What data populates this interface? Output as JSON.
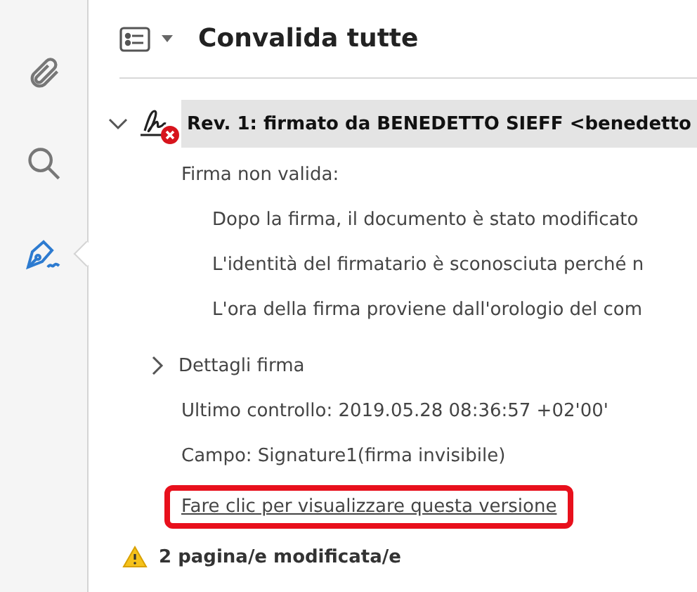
{
  "sidebar": {
    "tools": [
      {
        "kind": "attachment",
        "selected": false
      },
      {
        "kind": "search",
        "selected": false
      },
      {
        "kind": "signature",
        "selected": true
      }
    ]
  },
  "header": {
    "title": "Convalida tutte"
  },
  "signature": {
    "title": "Rev. 1: firmato da BENEDETTO SIEFF <benedetto",
    "selected": true,
    "expanded": true,
    "valid": false,
    "status": "Firma non valida:",
    "reasons": [
      "Dopo la firma, il documento è stato modificato",
      "L'identità del firmatario è sconosciuta perché n",
      "L'ora della firma proviene dall'orologio del com"
    ],
    "details": {
      "label": "Dettagli firma",
      "expanded": false
    },
    "last_check": "Ultimo controllo: 2019.05.28 08:36:57 +02'00'",
    "field": "Campo: Signature1(firma invisibile)",
    "link": {
      "label": "Fare clic per visualizzare questa versione",
      "highlighted": true
    }
  },
  "warning": {
    "label": "2 pagina/e modificata/e"
  }
}
